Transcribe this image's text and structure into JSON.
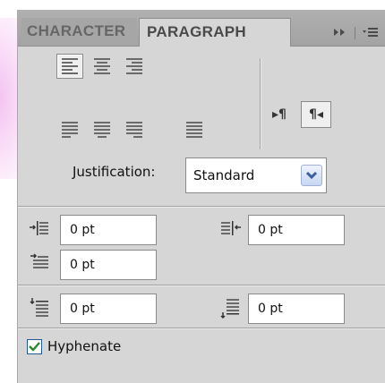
{
  "tabs": [
    {
      "label": "CHARACTER",
      "active": false
    },
    {
      "label": "PARAGRAPH",
      "active": true
    }
  ],
  "tab_controls": {
    "collapse_icon": "double-arrow-right-icon",
    "menu_icon": "panel-menu-icon"
  },
  "alignment_buttons": [
    {
      "name": "align-left",
      "selected": true
    },
    {
      "name": "align-center",
      "selected": false
    },
    {
      "name": "align-right",
      "selected": false
    },
    {
      "name": "justify-last-left",
      "selected": false
    },
    {
      "name": "justify-last-center",
      "selected": false
    },
    {
      "name": "justify-last-right",
      "selected": false
    },
    {
      "name": "justify-all",
      "selected": false
    }
  ],
  "direction": {
    "ltr_glyph": "▸¶",
    "rtl_glyph": "¶◂",
    "rtl_selected": true
  },
  "justification": {
    "label": "Justification:",
    "value": "Standard"
  },
  "fields": {
    "left_indent": "0 pt",
    "right_indent": "0 pt",
    "first_line_indent": "0 pt",
    "space_before": "0 pt",
    "space_after": "0 pt"
  },
  "hyphenate": {
    "label": "Hyphenate",
    "checked": true
  },
  "colors": {
    "panel_bg": "#d6d6d6",
    "tabbar_bg": "#a6a6a6",
    "accent_check": "#1f5a96"
  }
}
